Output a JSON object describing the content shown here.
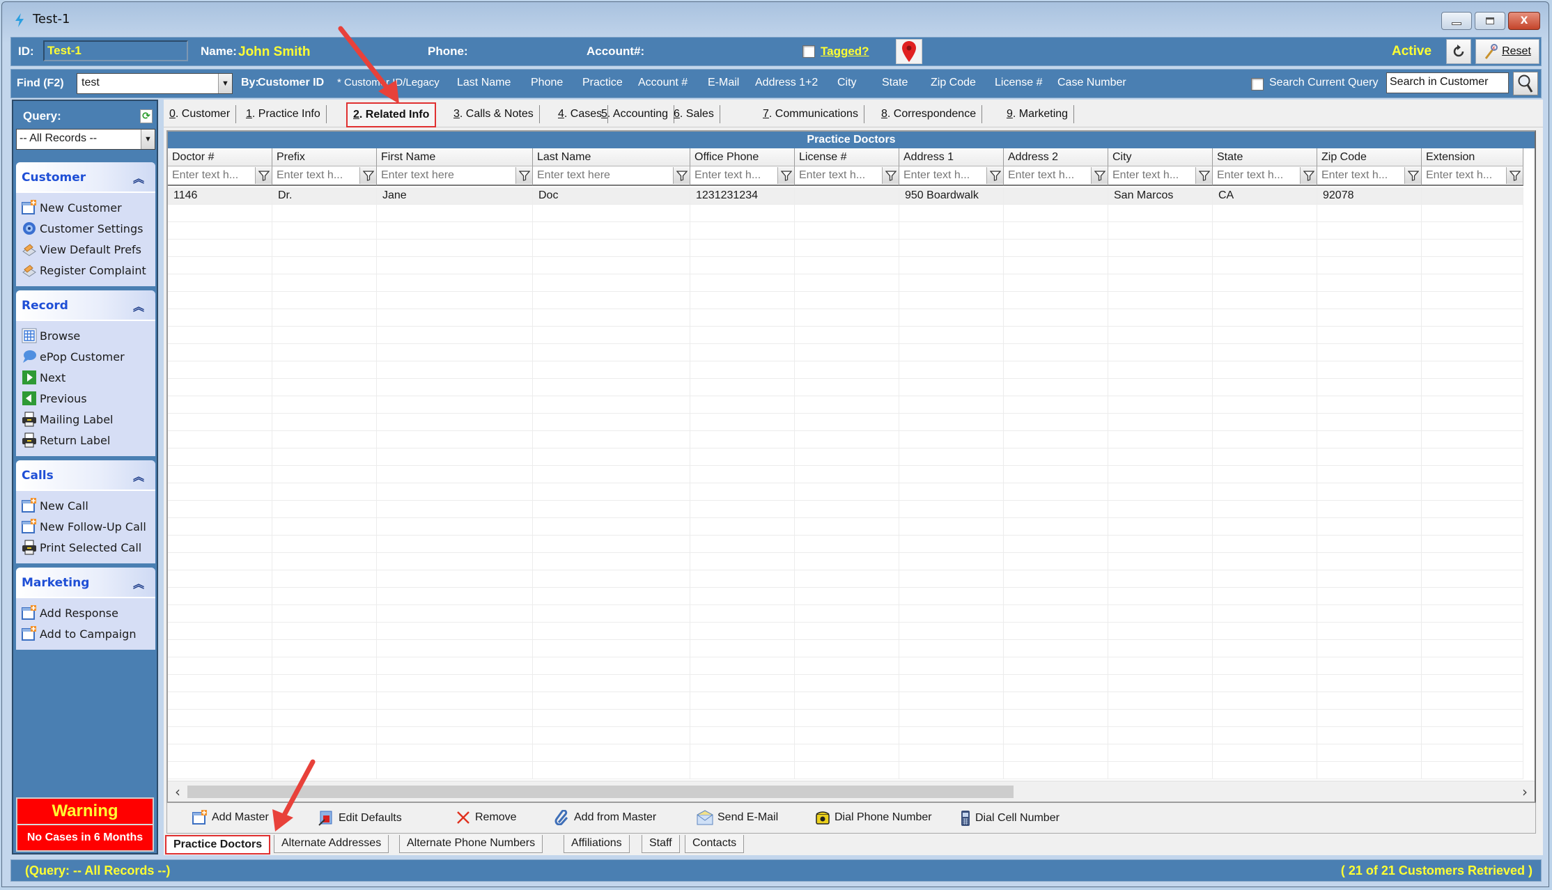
{
  "window": {
    "title": "Test-1",
    "controls": {
      "minimize": "—",
      "maximize": "▫",
      "close": "X"
    }
  },
  "header": {
    "id_label": "ID:",
    "id_value": "Test-1",
    "name_label": "Name:",
    "name_value": "John Smith",
    "phone_label": "Phone:",
    "phone_value": "",
    "account_label": "Account#:",
    "account_value": "",
    "tagged_label": "Tagged?",
    "tagged_checked": false,
    "status": "Active",
    "reset_label": "Reset"
  },
  "find": {
    "label": "Find (F2)",
    "value": "test",
    "by_label": "By:",
    "options": [
      {
        "label": "Customer ID",
        "selected": true
      },
      {
        "label": "* Customer ID/Legacy",
        "selected": false
      },
      {
        "label": "Last Name",
        "selected": false
      },
      {
        "label": "Phone",
        "selected": false
      },
      {
        "label": "Practice",
        "selected": false
      },
      {
        "label": "Account #",
        "selected": false
      },
      {
        "label": "E-Mail",
        "selected": false
      },
      {
        "label": "Address 1+2",
        "selected": false
      },
      {
        "label": "City",
        "selected": false
      },
      {
        "label": "State",
        "selected": false
      },
      {
        "label": "Zip Code",
        "selected": false
      },
      {
        "label": "License #",
        "selected": false
      },
      {
        "label": "Case Number",
        "selected": false
      }
    ],
    "search_current_query_label": "Search Current Query",
    "search_current_query_checked": false,
    "search_placeholder": "Search in Customer"
  },
  "sidebar": {
    "query_label": "Query:",
    "query_value": "-- All Records --",
    "panels": [
      {
        "title": "Customer",
        "items": [
          {
            "label": "New Customer",
            "icon": "new-doc-icon"
          },
          {
            "label": "Customer Settings",
            "icon": "gear-icon"
          },
          {
            "label": "View Default Prefs",
            "icon": "prefs-icon"
          },
          {
            "label": "Register Complaint",
            "icon": "prefs-icon"
          }
        ]
      },
      {
        "title": "Record",
        "items": [
          {
            "label": "Browse",
            "icon": "grid-icon"
          },
          {
            "label": "ePop Customer",
            "icon": "speech-bubble-icon"
          },
          {
            "label": "Next",
            "icon": "next-icon"
          },
          {
            "label": "Previous",
            "icon": "previous-icon"
          },
          {
            "label": "Mailing Label",
            "icon": "printer-icon"
          },
          {
            "label": "Return Label",
            "icon": "printer-icon"
          }
        ]
      },
      {
        "title": "Calls",
        "items": [
          {
            "label": "New Call",
            "icon": "new-doc-icon"
          },
          {
            "label": "New Follow-Up Call",
            "icon": "new-doc-icon"
          },
          {
            "label": "Print Selected Call",
            "icon": "printer-icon"
          }
        ]
      },
      {
        "title": "Marketing",
        "items": [
          {
            "label": "Add Response",
            "icon": "new-doc-icon"
          },
          {
            "label": "Add to Campaign",
            "icon": "new-doc-icon"
          }
        ]
      }
    ],
    "warning_title": "Warning",
    "warning_text": "No Cases in 6 Months"
  },
  "tabs": [
    {
      "key": "0",
      "label": ". Customer",
      "active": false
    },
    {
      "key": "1",
      "label": ". Practice Info",
      "active": false
    },
    {
      "key": "2",
      "label": ". Related Info",
      "active": true
    },
    {
      "key": "3",
      "label": ". Calls & Notes",
      "active": false
    },
    {
      "key": "4",
      "label": ". Cases",
      "active": false
    },
    {
      "key": "5",
      "label": ". Accounting",
      "active": false
    },
    {
      "key": "6",
      "label": ". Sales",
      "active": false
    },
    {
      "key": "7",
      "label": ". Communications",
      "active": false
    },
    {
      "key": "8",
      "label": ". Correspondence",
      "active": false
    },
    {
      "key": "9",
      "label": ". Marketing",
      "active": false
    }
  ],
  "grid": {
    "title": "Practice Doctors",
    "columns": [
      "Doctor #",
      "Prefix",
      "First Name",
      "Last Name",
      "Office Phone",
      "License #",
      "Address 1",
      "Address 2",
      "City",
      "State",
      "Zip Code",
      "Extension"
    ],
    "filter_placeholders": [
      "Enter text h...",
      "Enter text h...",
      "Enter text here",
      "Enter text here",
      "Enter text h...",
      "Enter text h...",
      "Enter text h...",
      "Enter text h...",
      "Enter text h...",
      "Enter text h...",
      "Enter text h...",
      "Enter text h..."
    ],
    "rows": [
      [
        "1146",
        "Dr.",
        "Jane",
        "Doc",
        "1231231234",
        "",
        "950 Boardwalk",
        "",
        "San Marcos",
        "CA",
        "92078",
        ""
      ]
    ]
  },
  "actions": [
    {
      "label": "Add Master",
      "icon": "new-doc-icon"
    },
    {
      "label": "Edit Defaults",
      "icon": "edit-defaults-icon"
    },
    {
      "label": "Remove",
      "icon": "remove-x-icon"
    },
    {
      "label": "Add from Master",
      "icon": "paperclip-icon"
    },
    {
      "label": "Send E-Mail",
      "icon": "envelope-icon"
    },
    {
      "label": "Dial Phone Number",
      "icon": "phone-icon"
    },
    {
      "label": "Dial Cell Number",
      "icon": "cellphone-icon"
    }
  ],
  "subtabs": [
    {
      "label": "Practice Doctors",
      "active": true
    },
    {
      "label": "Alternate Addresses",
      "active": false
    },
    {
      "label": "Alternate Phone Numbers",
      "active": false
    },
    {
      "label": "Affiliations",
      "active": false
    },
    {
      "label": "Staff",
      "active": false
    },
    {
      "label": "Contacts",
      "active": false
    }
  ],
  "status": {
    "left": "(Query: -- All Records --)",
    "right": "( 21 of 21 Customers Retrieved )"
  },
  "annotations": {
    "arrow_color": "#e8413a",
    "highlight_color": "#e03030"
  }
}
